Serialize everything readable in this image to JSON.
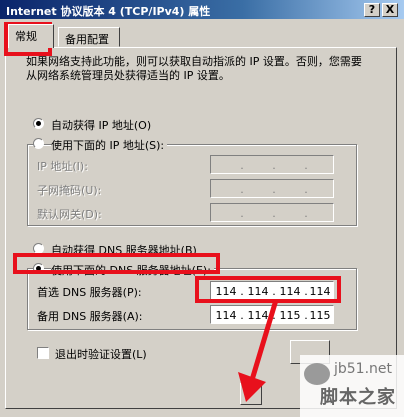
{
  "window": {
    "title": "Internet 协议版本 4 (TCP/IPv4) 属性",
    "help_button": "?",
    "close_button": "X"
  },
  "tabs": [
    {
      "label": "常规",
      "active": true
    },
    {
      "label": "备用配置",
      "active": false
    }
  ],
  "description": "如果网络支持此功能，则可以获取自动指派的 IP 设置。否则，您需要从网络系统管理员处获得适当的 IP 设置。",
  "ip_section": {
    "auto_label": "自动获得 IP 地址(O)",
    "auto_selected": true,
    "manual_label": "使用下面的 IP 地址(S):",
    "manual_selected": false,
    "fields": [
      {
        "label": "IP 地址(I):",
        "value": [
          " ",
          " ",
          " ",
          " "
        ]
      },
      {
        "label": "子网掩码(U):",
        "value": [
          " ",
          " ",
          " ",
          " "
        ]
      },
      {
        "label": "默认网关(D):",
        "value": [
          " ",
          " ",
          " ",
          " "
        ]
      }
    ]
  },
  "dns_section": {
    "auto_label": "自动获得 DNS 服务器地址(B)",
    "auto_selected": false,
    "manual_label": "使用下面的 DNS 服务器地址(E):",
    "manual_selected": true,
    "preferred_label": "首选 DNS 服务器(P):",
    "preferred_value": [
      "114",
      "114",
      "114",
      "114"
    ],
    "alternate_label": "备用 DNS 服务器(A):",
    "alternate_value": [
      "114",
      "114",
      "115",
      "115"
    ]
  },
  "validate_label": "退出时验证设置(L)",
  "validate_checked": false,
  "highlight_color": "#e8101c",
  "watermark": {
    "url": "jb51.net",
    "text": "脚本之家"
  }
}
